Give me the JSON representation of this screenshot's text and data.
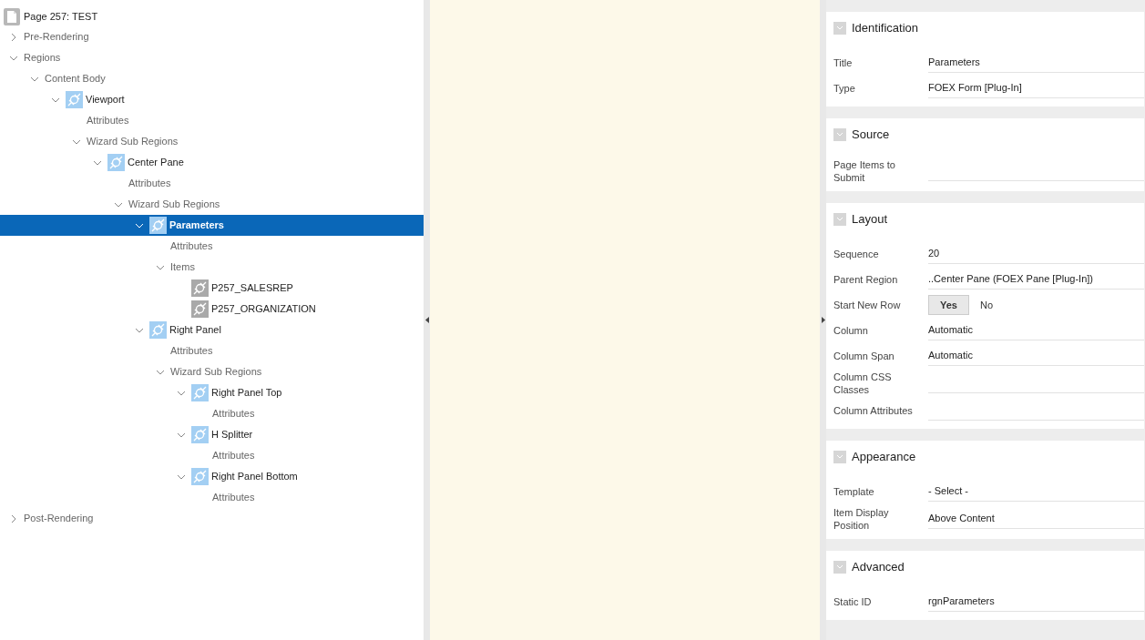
{
  "tree": {
    "label": "Page 257: TEST",
    "selected": false,
    "children": [
      {
        "label": "Pre-Rendering",
        "expanded": false,
        "selected": false
      },
      {
        "label": "Regions",
        "expanded": true,
        "selected": false,
        "children": [
          {
            "label": "Content Body",
            "expanded": true,
            "selected": false,
            "children": [
              {
                "label": "Viewport",
                "kind": "region",
                "expanded": true,
                "selected": false,
                "children": [
                  {
                    "label": "Attributes",
                    "selected": false
                  },
                  {
                    "label": "Wizard Sub Regions",
                    "expanded": true,
                    "selected": false,
                    "children": [
                      {
                        "label": "Center Pane",
                        "kind": "region",
                        "expanded": true,
                        "selected": false,
                        "children": [
                          {
                            "label": "Attributes",
                            "selected": false
                          },
                          {
                            "label": "Wizard Sub Regions",
                            "expanded": true,
                            "selected": false,
                            "children": [
                              {
                                "label": "Parameters",
                                "kind": "region",
                                "expanded": true,
                                "selected": true,
                                "children": [
                                  {
                                    "label": "Attributes",
                                    "selected": false
                                  },
                                  {
                                    "label": "Items",
                                    "expanded": true,
                                    "selected": false,
                                    "children": [
                                      {
                                        "label": "P257_SALESREP",
                                        "kind": "item",
                                        "selected": false
                                      },
                                      {
                                        "label": "P257_ORGANIZATION",
                                        "kind": "item",
                                        "selected": false
                                      }
                                    ]
                                  }
                                ]
                              },
                              {
                                "label": "Right Panel",
                                "kind": "region",
                                "expanded": true,
                                "selected": false,
                                "children": [
                                  {
                                    "label": "Attributes",
                                    "selected": false
                                  },
                                  {
                                    "label": "Wizard Sub Regions",
                                    "expanded": true,
                                    "selected": false,
                                    "children": [
                                      {
                                        "label": "Right Panel Top",
                                        "kind": "region",
                                        "expanded": true,
                                        "selected": false,
                                        "children": [
                                          {
                                            "label": "Attributes",
                                            "selected": false
                                          }
                                        ]
                                      },
                                      {
                                        "label": "H Splitter",
                                        "kind": "region",
                                        "expanded": true,
                                        "selected": false,
                                        "children": [
                                          {
                                            "label": "Attributes",
                                            "selected": false
                                          }
                                        ]
                                      },
                                      {
                                        "label": "Right Panel Bottom",
                                        "kind": "region",
                                        "expanded": true,
                                        "selected": false,
                                        "children": [
                                          {
                                            "label": "Attributes",
                                            "selected": false
                                          }
                                        ]
                                      }
                                    ]
                                  }
                                ]
                              }
                            ]
                          }
                        ]
                      }
                    ]
                  }
                ]
              }
            ]
          }
        ]
      },
      {
        "label": "Post-Rendering",
        "expanded": false,
        "selected": false
      }
    ]
  },
  "sections": [
    {
      "title": "Identification",
      "expanded": true,
      "properties": [
        {
          "label": "Title",
          "kind": "text",
          "value": "Parameters"
        },
        {
          "label": "Type",
          "kind": "text",
          "value": "FOEX Form [Plug-In]"
        }
      ]
    },
    {
      "title": "Source",
      "expanded": true,
      "properties": [
        {
          "label": "Page Items to Submit",
          "kind": "text"
        }
      ]
    },
    {
      "title": "Layout",
      "expanded": true,
      "properties": [
        {
          "label": "Sequence",
          "kind": "text",
          "value": "20"
        },
        {
          "label": "Parent Region",
          "kind": "text",
          "value": "..Center Pane (FOEX Pane [Plug-In])"
        },
        {
          "label": "Start New Row",
          "kind": "toggle",
          "options": [
            {
              "label": "Yes",
              "selected": true
            },
            {
              "label": "No",
              "selected": false
            }
          ]
        },
        {
          "label": "Column",
          "kind": "text",
          "value": "Automatic"
        },
        {
          "label": "Column Span",
          "kind": "text",
          "value": "Automatic"
        },
        {
          "label": "Column CSS Classes",
          "kind": "text"
        },
        {
          "label": "Column Attributes",
          "kind": "text"
        }
      ]
    },
    {
      "title": "Appearance",
      "expanded": true,
      "properties": [
        {
          "label": "Template",
          "kind": "text",
          "value": "- Select -"
        },
        {
          "label": "Item Display Position",
          "kind": "text",
          "value": "Above Content"
        }
      ]
    },
    {
      "title": "Advanced",
      "expanded": true,
      "properties": [
        {
          "label": "Static ID",
          "kind": "text",
          "value": "rgnParameters"
        }
      ]
    }
  ]
}
